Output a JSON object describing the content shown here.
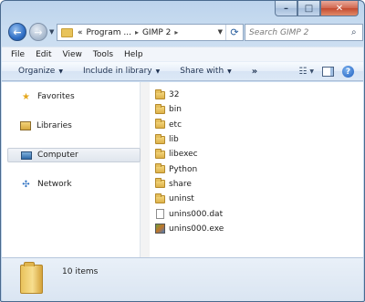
{
  "window": {
    "caption_buttons": [
      "minimize",
      "maximize",
      "close"
    ]
  },
  "address_bar": {
    "overflow_marker": "«",
    "crumbs": [
      "Program ...",
      "GIMP 2"
    ],
    "search_placeholder": "Search GIMP 2"
  },
  "menu": {
    "items": [
      "File",
      "Edit",
      "View",
      "Tools",
      "Help"
    ]
  },
  "commands": {
    "organize": "Organize",
    "include_in_library": "Include in library",
    "share_with": "Share with",
    "more": "»"
  },
  "nav_pane": {
    "favorites": "Favorites",
    "libraries": "Libraries",
    "computer": "Computer",
    "network": "Network"
  },
  "files": [
    {
      "name": "32",
      "type": "folder"
    },
    {
      "name": "bin",
      "type": "folder"
    },
    {
      "name": "etc",
      "type": "folder"
    },
    {
      "name": "lib",
      "type": "folder"
    },
    {
      "name": "libexec",
      "type": "folder"
    },
    {
      "name": "Python",
      "type": "folder"
    },
    {
      "name": "share",
      "type": "folder"
    },
    {
      "name": "uninst",
      "type": "folder"
    },
    {
      "name": "unins000.dat",
      "type": "document"
    },
    {
      "name": "unins000.exe",
      "type": "executable"
    }
  ],
  "details": {
    "item_count": "10 items"
  },
  "colors": {
    "frame": "#bcd3ec",
    "commandbar": "#dce8f6",
    "selection": "#dfe5ed"
  }
}
